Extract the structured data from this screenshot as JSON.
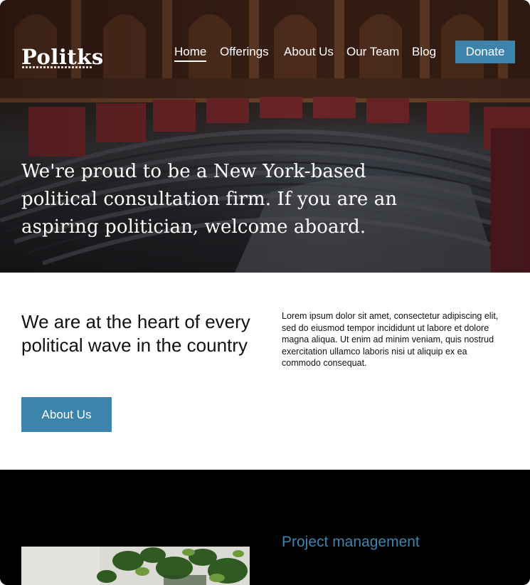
{
  "brand": {
    "logo_text": "Politks"
  },
  "nav": {
    "items": [
      {
        "label": "Home",
        "active": true
      },
      {
        "label": "Offerings",
        "active": false
      },
      {
        "label": "About Us",
        "active": false
      },
      {
        "label": "Our Team",
        "active": false
      },
      {
        "label": "Blog",
        "active": false
      }
    ],
    "donate_label": "Donate"
  },
  "hero": {
    "headline": "We're proud to be a New York-based political consultation firm. If you are an aspiring politician, welcome aboard.",
    "image": "parliament-chamber-photo"
  },
  "intro": {
    "heading": "We are at the heart of every political wave in the country",
    "body": "Lorem ipsum dolor sit amet, consectetur adipiscing elit, sed do eiusmod tempor incididunt ut labore et dolore magna aliqua. Ut enim ad minim veniam, quis nostrud exercitation ullamco laboris nisi ut aliquip ex ea commodo consequat.",
    "button_label": "About Us"
  },
  "services": {
    "first_title": "Project management",
    "image": "plant-wall-photo"
  },
  "colors": {
    "accent": "#3d84ad",
    "dark_section": "#000000",
    "text": "#111111"
  }
}
